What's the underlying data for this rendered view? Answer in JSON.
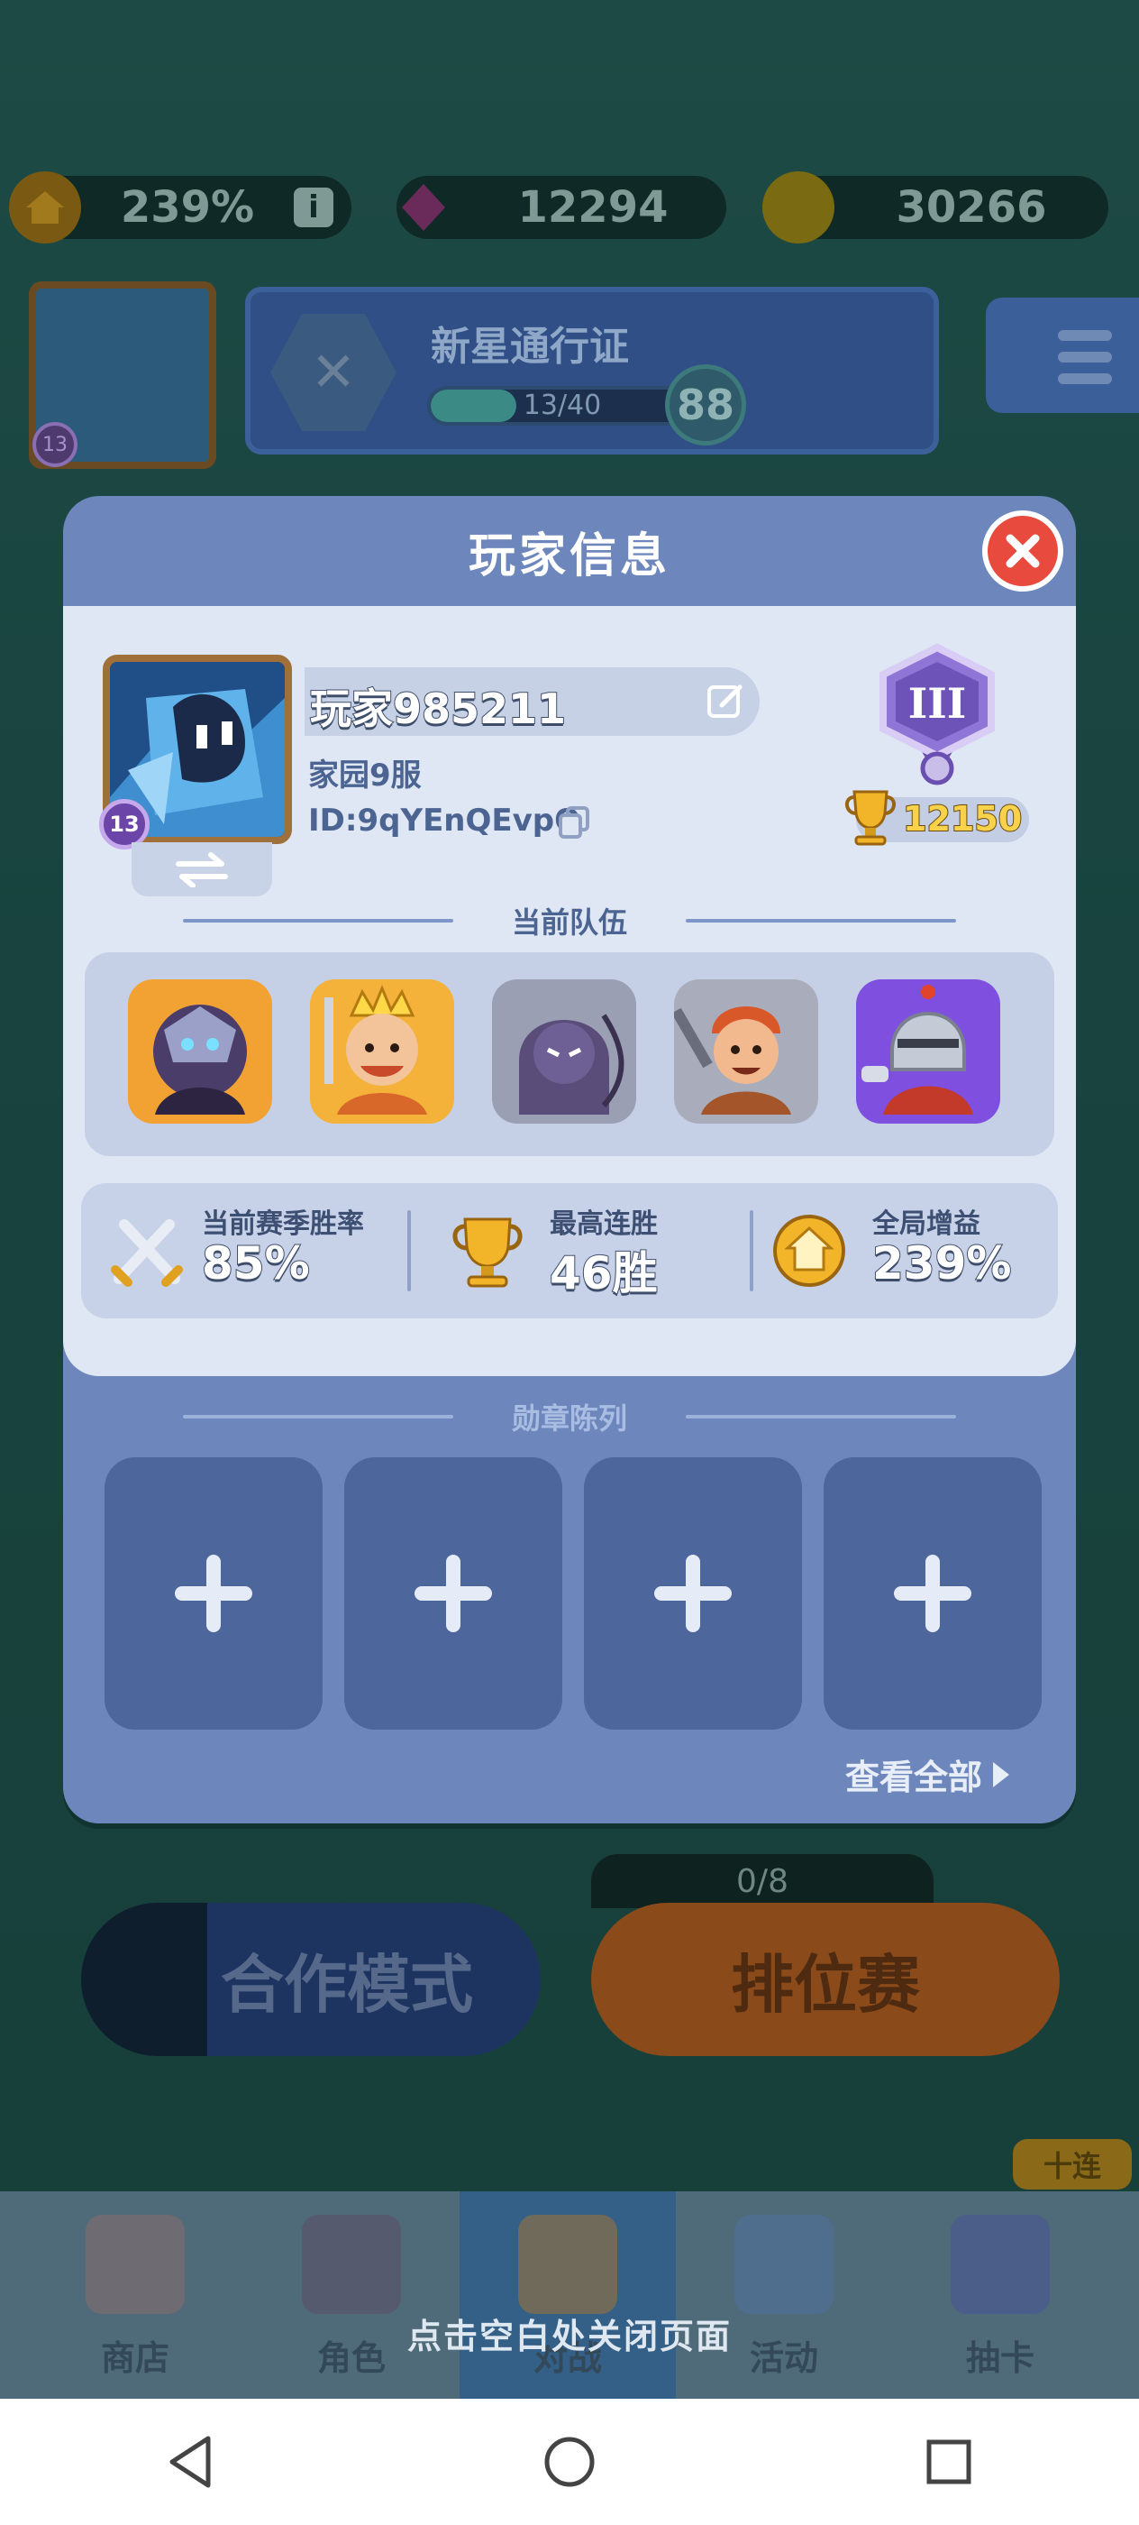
{
  "hud": {
    "boost": "239%",
    "gems": "12294",
    "coins": "30266",
    "level": "13"
  },
  "pass": {
    "title": "新星通行证",
    "progress": "13/40",
    "progress_fraction": 0.325,
    "level": "88"
  },
  "modal": {
    "title": "玩家信息",
    "player": {
      "name": "玩家985211",
      "server": "家园9服",
      "id": "ID:9qYEnQEvpQ",
      "level": "13",
      "trophies": "12150",
      "rank_numeral": "III"
    },
    "team_title": "当前队伍",
    "team": [
      {
        "name": "hero-dark-knight",
        "bg": "#f2a133"
      },
      {
        "name": "hero-king",
        "bg": "#f4b23a"
      },
      {
        "name": "hero-shadow-archer",
        "bg": "#9a9fb4"
      },
      {
        "name": "hero-barbarian",
        "bg": "#a9adbb"
      },
      {
        "name": "hero-knight",
        "bg": "#7f4fe0"
      }
    ],
    "stats": {
      "winrate_label": "当前赛季胜率",
      "winrate_value": "85%",
      "streak_label": "最高连胜",
      "streak_value": "46胜",
      "boost_label": "全局增益",
      "boost_value": "239%"
    },
    "medals_title": "勋章陈列",
    "medal_slots": [
      "+",
      "+",
      "+",
      "+"
    ],
    "view_all": "查看全部"
  },
  "lobby": {
    "coop_mode": "合作模式",
    "ranked": "排位赛",
    "ranked_progress": "0/8",
    "ten_pull": "十连",
    "nav": [
      "商店",
      "角色",
      "对战",
      "活动",
      "抽卡"
    ]
  },
  "close_hint": "点击空白处关闭页面",
  "colors": {
    "modal_bg": "#6d87bd",
    "card_bg": "#dfe6f4",
    "close_red": "#e94a3e",
    "accent_text": "#4c6491"
  }
}
